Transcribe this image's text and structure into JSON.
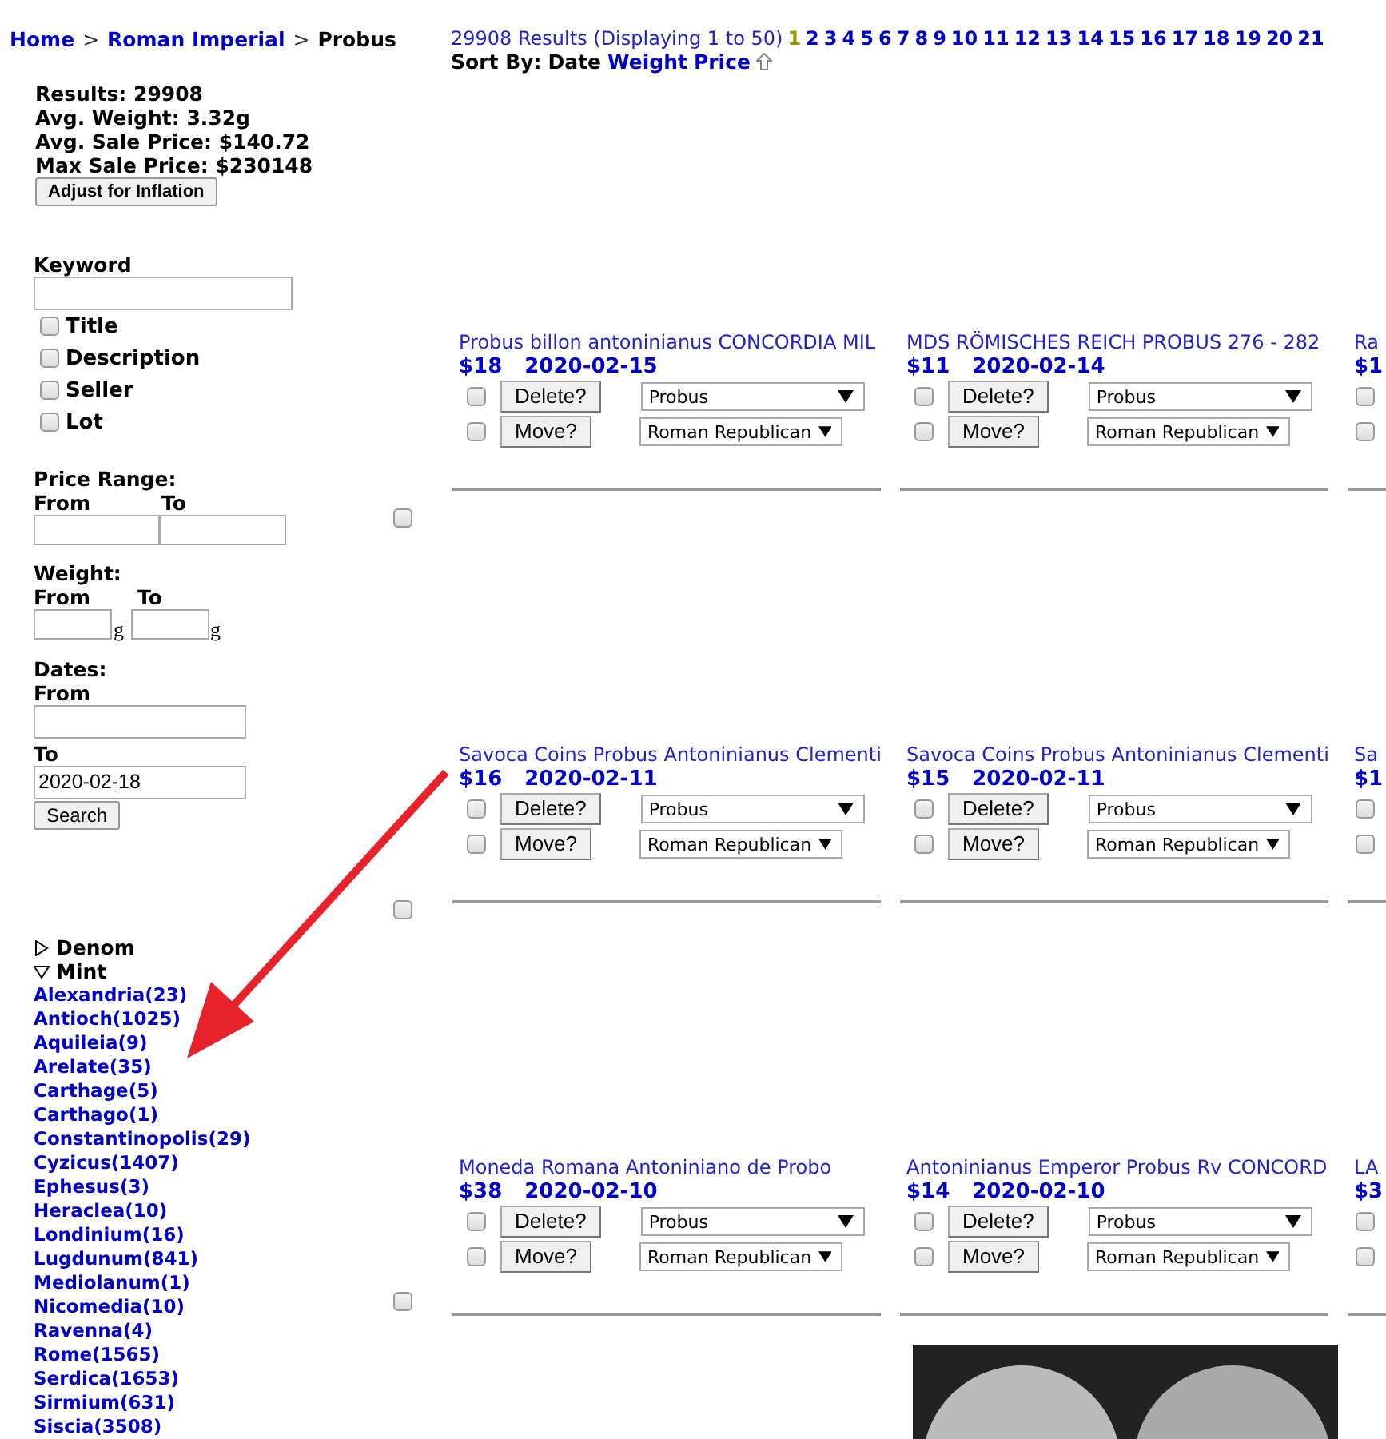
{
  "breadcrumb": {
    "separator": ">",
    "items": [
      {
        "label": "Home",
        "link": true
      },
      {
        "label": "Roman Imperial",
        "link": true
      },
      {
        "label": "Probus",
        "link": false
      }
    ]
  },
  "results_summary": "29908 Results (Displaying 1 to 50)",
  "pages": [
    {
      "label": "1",
      "selected": true
    },
    {
      "label": "2",
      "selected": false
    },
    {
      "label": "3",
      "selected": false
    },
    {
      "label": "4",
      "selected": false
    },
    {
      "label": "5",
      "selected": false
    },
    {
      "label": "6",
      "selected": false
    },
    {
      "label": "7",
      "selected": false
    },
    {
      "label": "8",
      "selected": false
    },
    {
      "label": "9",
      "selected": false
    },
    {
      "label": "10",
      "selected": false
    },
    {
      "label": "11",
      "selected": false
    },
    {
      "label": "12",
      "selected": false
    },
    {
      "label": "13",
      "selected": false
    },
    {
      "label": "14",
      "selected": false
    },
    {
      "label": "15",
      "selected": false
    },
    {
      "label": "16",
      "selected": false
    },
    {
      "label": "17",
      "selected": false
    },
    {
      "label": "18",
      "selected": false
    },
    {
      "label": "19",
      "selected": false
    },
    {
      "label": "20",
      "selected": false
    },
    {
      "label": "21",
      "selected": false
    }
  ],
  "sort": {
    "label": "Sort By:",
    "options": [
      {
        "label": "Date",
        "selected": true
      },
      {
        "label": "Weight",
        "selected": false
      },
      {
        "label": "Price",
        "selected": false
      }
    ]
  },
  "stats": [
    "Results: 29908",
    "Avg. Weight: 3.32g",
    "Avg. Sale Price: $140.72",
    "Max Sale Price: $230148"
  ],
  "inflation_button": "Adjust for Inflation",
  "keyword": {
    "label": "Keyword",
    "options": [
      {
        "label": "Title",
        "checked": false
      },
      {
        "label": "Description",
        "checked": false
      },
      {
        "label": "Seller",
        "checked": false
      },
      {
        "label": "Lot",
        "checked": false
      }
    ]
  },
  "price_range": {
    "label": "Price Range:",
    "from_label": "From",
    "to_label": "To"
  },
  "weight": {
    "label": "Weight:",
    "from_label": "From",
    "to_label": "To",
    "from_unit": "g",
    "to_unit": "g"
  },
  "dates": {
    "label": "Dates:",
    "from_label": "From",
    "to_label": "To",
    "to_value": "2020-02-18"
  },
  "search_button": "Search",
  "side_checkboxes": [
    {
      "checked": false
    },
    {
      "checked": false
    },
    {
      "checked": false
    }
  ],
  "filters": [
    {
      "label": "Denom",
      "expanded": false
    },
    {
      "label": "Mint",
      "expanded": true,
      "children": [
        {
          "label": "Alexandria(23)"
        },
        {
          "label": "Antioch(1025)"
        },
        {
          "label": "Aquileia(9)"
        },
        {
          "label": "Arelate(35)"
        },
        {
          "label": "Carthage(5)"
        },
        {
          "label": "Carthago(1)"
        },
        {
          "label": "Constantinopolis(29)"
        },
        {
          "label": "Cyzicus(1407)"
        },
        {
          "label": "Ephesus(3)"
        },
        {
          "label": "Heraclea(10)"
        },
        {
          "label": "Londinium(16)"
        },
        {
          "label": "Lugdunum(841)"
        },
        {
          "label": "Mediolanum(1)"
        },
        {
          "label": "Nicomedia(10)"
        },
        {
          "label": "Ravenna(4)"
        },
        {
          "label": "Rome(1565)"
        },
        {
          "label": "Serdica(1653)"
        },
        {
          "label": "Sirmium(631)"
        },
        {
          "label": "Siscia(3508)"
        }
      ]
    }
  ],
  "cards": [
    {
      "kind": "full",
      "title": "Probus billon antoninianus CONCORDIA MIL",
      "price": "$18",
      "date": "2020-02-15",
      "delete_checked": false,
      "move_checked": false,
      "delete": "Delete?",
      "move": "Move?",
      "category": "Probus",
      "move_to": "Roman Republican"
    },
    {
      "kind": "full",
      "title": "MDS RÖMISCHES REICH PROBUS 276 - 282",
      "price": "$11",
      "date": "2020-02-14",
      "delete_checked": false,
      "move_checked": false,
      "delete": "Delete?",
      "move": "Move?",
      "category": "Probus",
      "move_to": "Roman Republican"
    },
    {
      "kind": "partial",
      "title": "Ra",
      "price": "$1",
      "delete_checked": false,
      "move_checked": false
    },
    {
      "kind": "full",
      "title": "Savoca Coins Probus Antoninianus Clementi",
      "price": "$16",
      "date": "2020-02-11",
      "delete_checked": false,
      "move_checked": false,
      "delete": "Delete?",
      "move": "Move?",
      "category": "Probus",
      "move_to": "Roman Republican"
    },
    {
      "kind": "full",
      "title": "Savoca Coins Probus Antoninianus Clementi",
      "price": "$15",
      "date": "2020-02-11",
      "delete_checked": false,
      "move_checked": false,
      "delete": "Delete?",
      "move": "Move?",
      "category": "Probus",
      "move_to": "Roman Republican"
    },
    {
      "kind": "partial",
      "title": "Sa",
      "price": "$1",
      "delete_checked": false,
      "move_checked": false
    },
    {
      "kind": "full",
      "title": "Moneda Romana Antoniniano de Probo",
      "price": "$38",
      "date": "2020-02-10",
      "delete_checked": false,
      "move_checked": false,
      "delete": "Delete?",
      "move": "Move?",
      "category": "Probus",
      "move_to": "Roman Republican"
    },
    {
      "kind": "full",
      "title": "Antoninianus Emperor Probus Rv CONCORD",
      "price": "$14",
      "date": "2020-02-10",
      "delete_checked": false,
      "move_checked": false,
      "delete": "Delete?",
      "move": "Move?",
      "category": "Probus",
      "move_to": "Roman Republican"
    },
    {
      "kind": "partial",
      "title": "LA",
      "price": "$3",
      "delete_checked": false,
      "move_checked": false
    },
    {
      "kind": "empty"
    },
    {
      "kind": "photo"
    },
    {
      "kind": "empty"
    }
  ]
}
